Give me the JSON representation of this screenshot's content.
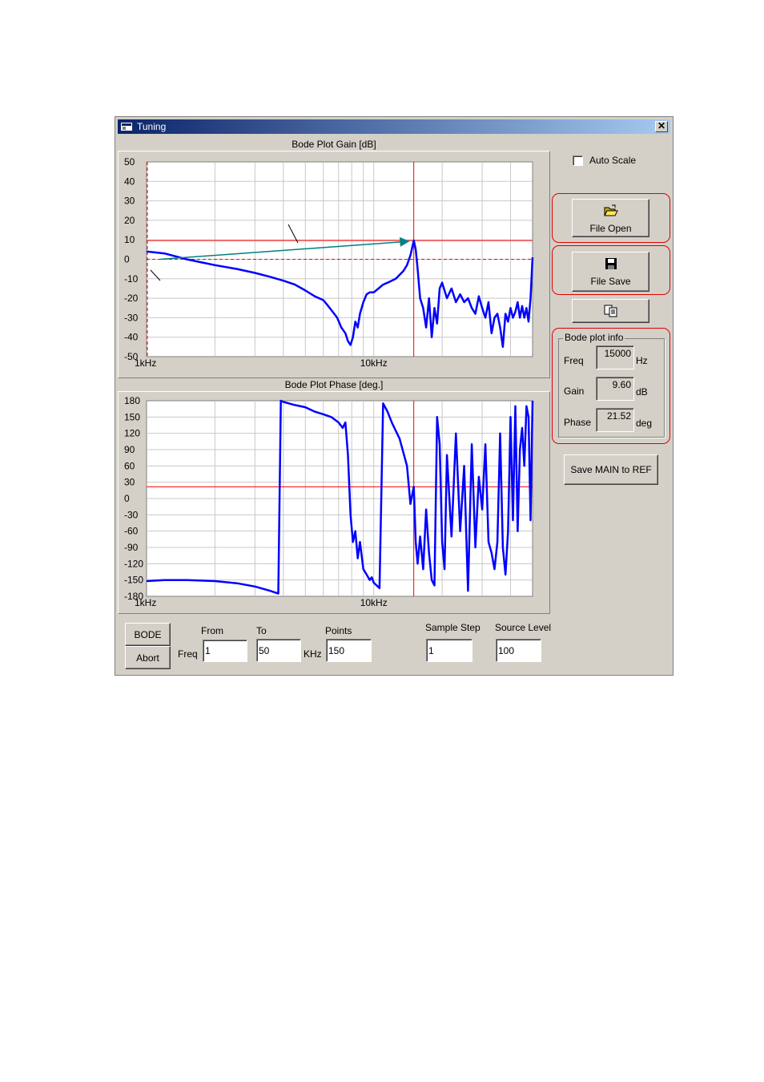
{
  "window": {
    "title": "Tuning",
    "close_symbol": "✕"
  },
  "gain_chart": {
    "title": "Bode Plot Gain [dB]"
  },
  "phase_chart": {
    "title": "Bode Plot Phase [deg.]"
  },
  "chart_data": [
    {
      "type": "line",
      "title": "Bode Plot Gain [dB]",
      "x_scale": "log",
      "xlim": [
        1000,
        50000
      ],
      "x_tick_labels": [
        {
          "x": 1000,
          "label": "1kHz"
        },
        {
          "x": 10000,
          "label": "10kHz"
        }
      ],
      "ylim": [
        -50,
        50
      ],
      "y_ticks": [
        50,
        40,
        30,
        20,
        10,
        0,
        -10,
        -20,
        -30,
        -40,
        -50
      ],
      "grid": true,
      "cursor": {
        "x": 15000,
        "y": 9.6
      },
      "reference_line_y": 0,
      "series": [
        {
          "color": "#0000ff",
          "x": [
            1000,
            1200,
            1500,
            2000,
            2500,
            3000,
            3500,
            4000,
            4500,
            5000,
            5500,
            6000,
            6300,
            6600,
            6900,
            7200,
            7500,
            7700,
            7900,
            8100,
            8300,
            8500,
            8700,
            9000,
            9300,
            9600,
            10000,
            10500,
            11000,
            11500,
            12000,
            12500,
            13000,
            13500,
            14000,
            14500,
            15000,
            15300,
            15600,
            16000,
            16500,
            17000,
            17500,
            18000,
            18500,
            19000,
            19500,
            20000,
            21000,
            22000,
            23000,
            24000,
            25000,
            26000,
            27000,
            28000,
            29000,
            30000,
            31000,
            32000,
            33000,
            34000,
            35000,
            36000,
            37000,
            38000,
            39000,
            40000,
            41000,
            42000,
            43000,
            44000,
            45000,
            46000,
            47000,
            48000,
            49000,
            50000
          ],
          "y": [
            4,
            3,
            0,
            -3,
            -5,
            -7,
            -9,
            -11,
            -13,
            -16,
            -19,
            -21,
            -24,
            -27,
            -30,
            -35,
            -38,
            -42,
            -44,
            -40,
            -32,
            -35,
            -28,
            -22,
            -18,
            -17,
            -17,
            -15,
            -13,
            -12,
            -11,
            -10,
            -8,
            -6,
            -3,
            2,
            9.6,
            5,
            -5,
            -20,
            -25,
            -35,
            -20,
            -40,
            -25,
            -33,
            -15,
            -12,
            -20,
            -15,
            -22,
            -18,
            -22,
            -20,
            -25,
            -28,
            -19,
            -25,
            -30,
            -22,
            -38,
            -30,
            -28,
            -35,
            -45,
            -28,
            -32,
            -25,
            -30,
            -27,
            -22,
            -30,
            -24,
            -30,
            -25,
            -32,
            -20,
            1
          ]
        }
      ]
    },
    {
      "type": "line",
      "title": "Bode Plot Phase [deg.]",
      "x_scale": "log",
      "xlim": [
        1000,
        50000
      ],
      "x_tick_labels": [
        {
          "x": 1000,
          "label": "1kHz"
        },
        {
          "x": 10000,
          "label": "10kHz"
        }
      ],
      "ylim": [
        -180,
        180
      ],
      "y_ticks": [
        180,
        150,
        120,
        90,
        60,
        30,
        0,
        -30,
        -60,
        -90,
        -120,
        -150,
        -180
      ],
      "grid": true,
      "cursor": {
        "x": 15000,
        "y": 21.52
      },
      "series": [
        {
          "color": "#0000ff",
          "x": [
            1000,
            1200,
            1500,
            2000,
            2500,
            3000,
            3500,
            3800,
            3900,
            4000,
            4500,
            5000,
            5500,
            6000,
            6500,
            7000,
            7300,
            7500,
            7700,
            7900,
            8100,
            8300,
            8500,
            8700,
            9000,
            9300,
            9600,
            9800,
            10000,
            10300,
            10600,
            11000,
            11500,
            12000,
            13000,
            14000,
            14500,
            15000,
            15300,
            15600,
            16000,
            16500,
            17000,
            17500,
            18000,
            18500,
            19000,
            19500,
            20000,
            20500,
            21000,
            22000,
            23000,
            24000,
            25000,
            26000,
            27000,
            28000,
            29000,
            30000,
            31000,
            32000,
            33000,
            34000,
            35000,
            36000,
            37000,
            38000,
            39000,
            40000,
            41000,
            42000,
            43000,
            44000,
            45000,
            46000,
            47000,
            48000,
            49000,
            50000
          ],
          "y": [
            -152,
            -150,
            -150,
            -152,
            -156,
            -162,
            -170,
            -175,
            180,
            178,
            172,
            168,
            160,
            155,
            150,
            140,
            130,
            140,
            80,
            -30,
            -80,
            -60,
            -110,
            -80,
            -130,
            -140,
            -150,
            -145,
            -155,
            -160,
            -165,
            175,
            160,
            140,
            110,
            60,
            -10,
            21.52,
            -80,
            -120,
            -70,
            -130,
            -20,
            -100,
            -150,
            -160,
            150,
            100,
            -80,
            -130,
            80,
            -70,
            120,
            -60,
            60,
            -170,
            100,
            -90,
            40,
            -20,
            100,
            -80,
            -100,
            -130,
            -80,
            120,
            -90,
            -140,
            -60,
            150,
            -40,
            170,
            -60,
            90,
            130,
            60,
            170,
            150,
            -40,
            180
          ]
        }
      ]
    }
  ],
  "controls": {
    "auto_scale": "Auto Scale",
    "file_open": "File Open",
    "file_save": "File Save",
    "copy_icon": "copy-icon",
    "save_main_to_ref": "Save MAIN to REF",
    "bode_button": "BODE",
    "abort_button": "Abort"
  },
  "bode_info": {
    "title": "Bode plot info",
    "freq_label": "Freq",
    "freq_value": "15000",
    "freq_unit": "Hz",
    "gain_label": "Gain",
    "gain_value": "9.60",
    "gain_unit": "dB",
    "phase_label": "Phase",
    "phase_value": "21.52",
    "phase_unit": "deg"
  },
  "sweep": {
    "freq_label": "Freq",
    "from_label": "From",
    "from_value": "1",
    "to_label": "To",
    "to_value": "50",
    "khz_label": "KHz",
    "points_label": "Points",
    "points_value": "150",
    "sample_step_label": "Sample Step",
    "sample_step_value": "1",
    "source_level_label": "Source Level",
    "source_level_value": "100"
  },
  "colors": {
    "trace": "#0000ff",
    "cursor": "#ff0000",
    "grid": "#c8c8c8",
    "highlight": "#e00000",
    "annotation_arrow": "#008080"
  }
}
